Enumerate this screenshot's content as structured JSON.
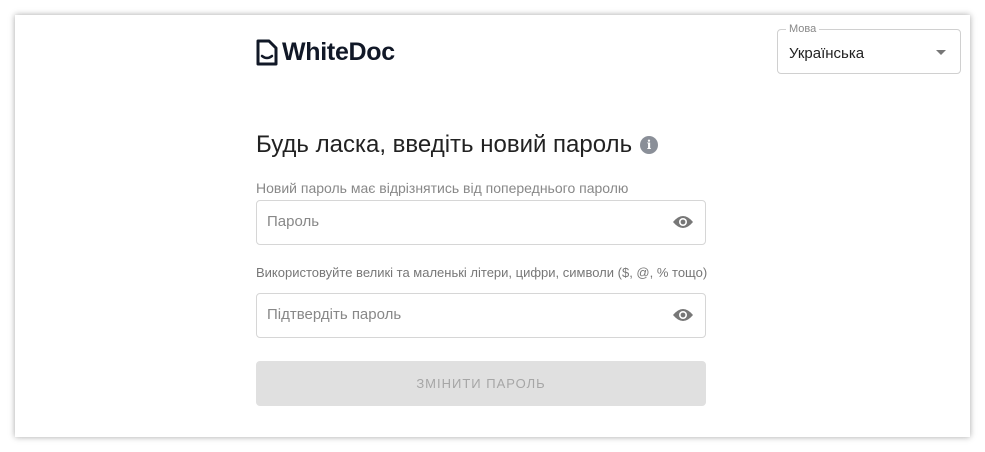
{
  "app": {
    "name": "WhiteDoc"
  },
  "language": {
    "label": "Мова",
    "value": "Українська"
  },
  "form": {
    "title": "Будь ласка, введіть новий пароль",
    "hint_top": "Новий пароль має відрізнятись від попереднього паролю",
    "password_placeholder": "Пароль",
    "hint_middle": "Використовуйте великі та маленькі літери, цифри, символи ($, @, % тощо)",
    "confirm_placeholder": "Підтвердіть пароль",
    "submit_label": "ЗМІНИТИ ПАРОЛЬ"
  }
}
